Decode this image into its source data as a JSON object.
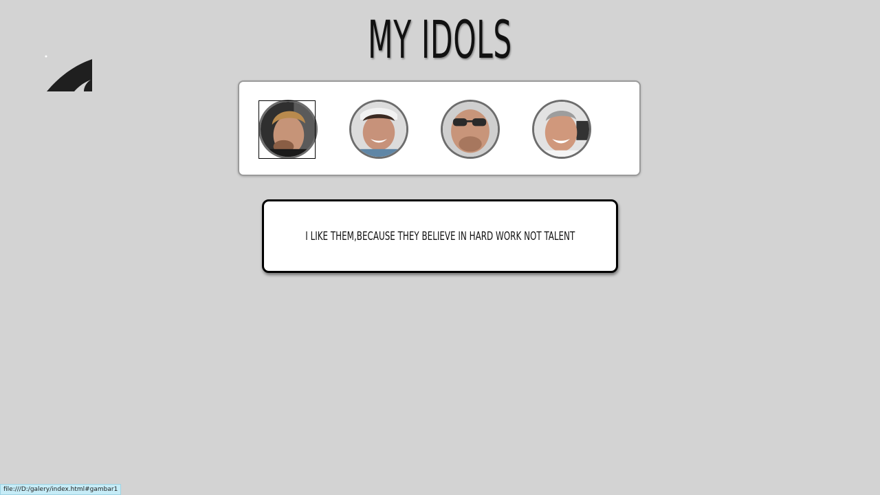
{
  "page": {
    "title": "MY IDOLS"
  },
  "gallery": {
    "items": [
      {
        "name": "idol-1",
        "href": "#gambar1",
        "skin": "#c69478",
        "hair": "#b98a4d",
        "bg": "#3a3a3a"
      },
      {
        "name": "idol-2",
        "href": "#gambar2",
        "skin": "#c7927a",
        "hair": "#3b2a22",
        "bg": "#d9d9d9"
      },
      {
        "name": "idol-3",
        "href": "#gambar3",
        "skin": "#c8957a",
        "hair": "#b08a6f",
        "bg": "#cfcfcf"
      },
      {
        "name": "idol-4",
        "href": "#gambar4",
        "skin": "#d0987c",
        "hair": "#9d9d9d",
        "bg": "#e2e2e2"
      }
    ]
  },
  "caption": {
    "text": "I LIKE THEM,BECAUSE THEY BELIEVE IN HARD WORK NOT TALENT"
  },
  "statusbar": {
    "url": "file:///D:/galery/index.html#gambar1"
  },
  "colors": {
    "background": "#d3d3d3",
    "panel": "#ffffff",
    "accent": "#000000"
  }
}
